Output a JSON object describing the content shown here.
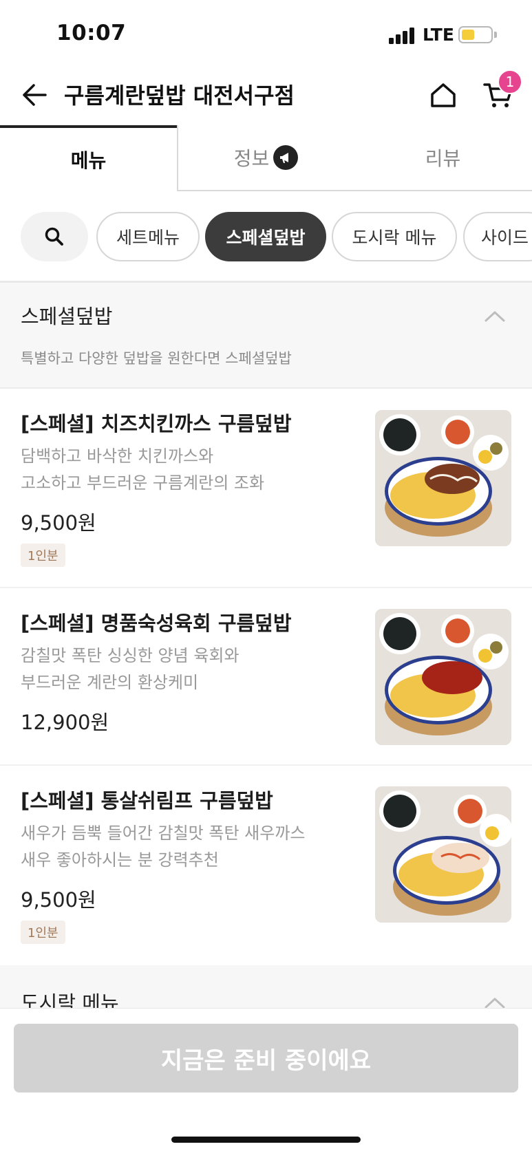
{
  "status_bar": {
    "time": "10:07",
    "network": "LTE",
    "battery_level": 0.45,
    "battery_color": "#f5cd3a"
  },
  "header": {
    "title": "구름계란덮밥 대전서구점",
    "cart_count": "1",
    "badge_color": "#e6448f"
  },
  "tabs": [
    {
      "label": "메뉴",
      "active": true
    },
    {
      "label": "정보",
      "active": false,
      "icon": "megaphone-icon"
    },
    {
      "label": "리뷰",
      "active": false
    }
  ],
  "categories": {
    "search_icon": "search-icon",
    "chips": [
      {
        "label": "세트메뉴",
        "active": false
      },
      {
        "label": "스페셜덮밥",
        "active": true
      },
      {
        "label": "도시락 메뉴",
        "active": false
      },
      {
        "label": "사이드",
        "active": false
      }
    ]
  },
  "section": {
    "title": "스페셜덮밥",
    "description": "특별하고 다양한 덮밥을 원한다면 스페셜덮밥",
    "expanded": true
  },
  "items": [
    {
      "name": "[스페셜] 치즈치킨까스 구름덮밥",
      "desc_line1": "담백하고 바삭한 치킨까스와",
      "desc_line2": "고소하고 부드러운 구름계란의 조화",
      "price": "9,500원",
      "tag": "1인분"
    },
    {
      "name": "[스페셜] 명품숙성육회 구름덮밥",
      "desc_line1": "감칠맛 폭탄 싱싱한 양념 육회와",
      "desc_line2": "부드러운 계란의 환상케미",
      "price": "12,900원"
    },
    {
      "name": "[스페셜] 통살쉬림프 구름덮밥",
      "desc_line1": "새우가 듬뿍 들어간 감칠맛 폭탄 새우까스",
      "desc_line2": "새우 좋아하시는 분 강력추천",
      "price": "9,500원",
      "tag": "1인분"
    }
  ],
  "next_section": {
    "title": "도시락 메뉴"
  },
  "bottom": {
    "button_label": "지금은 준비 중이에요"
  }
}
